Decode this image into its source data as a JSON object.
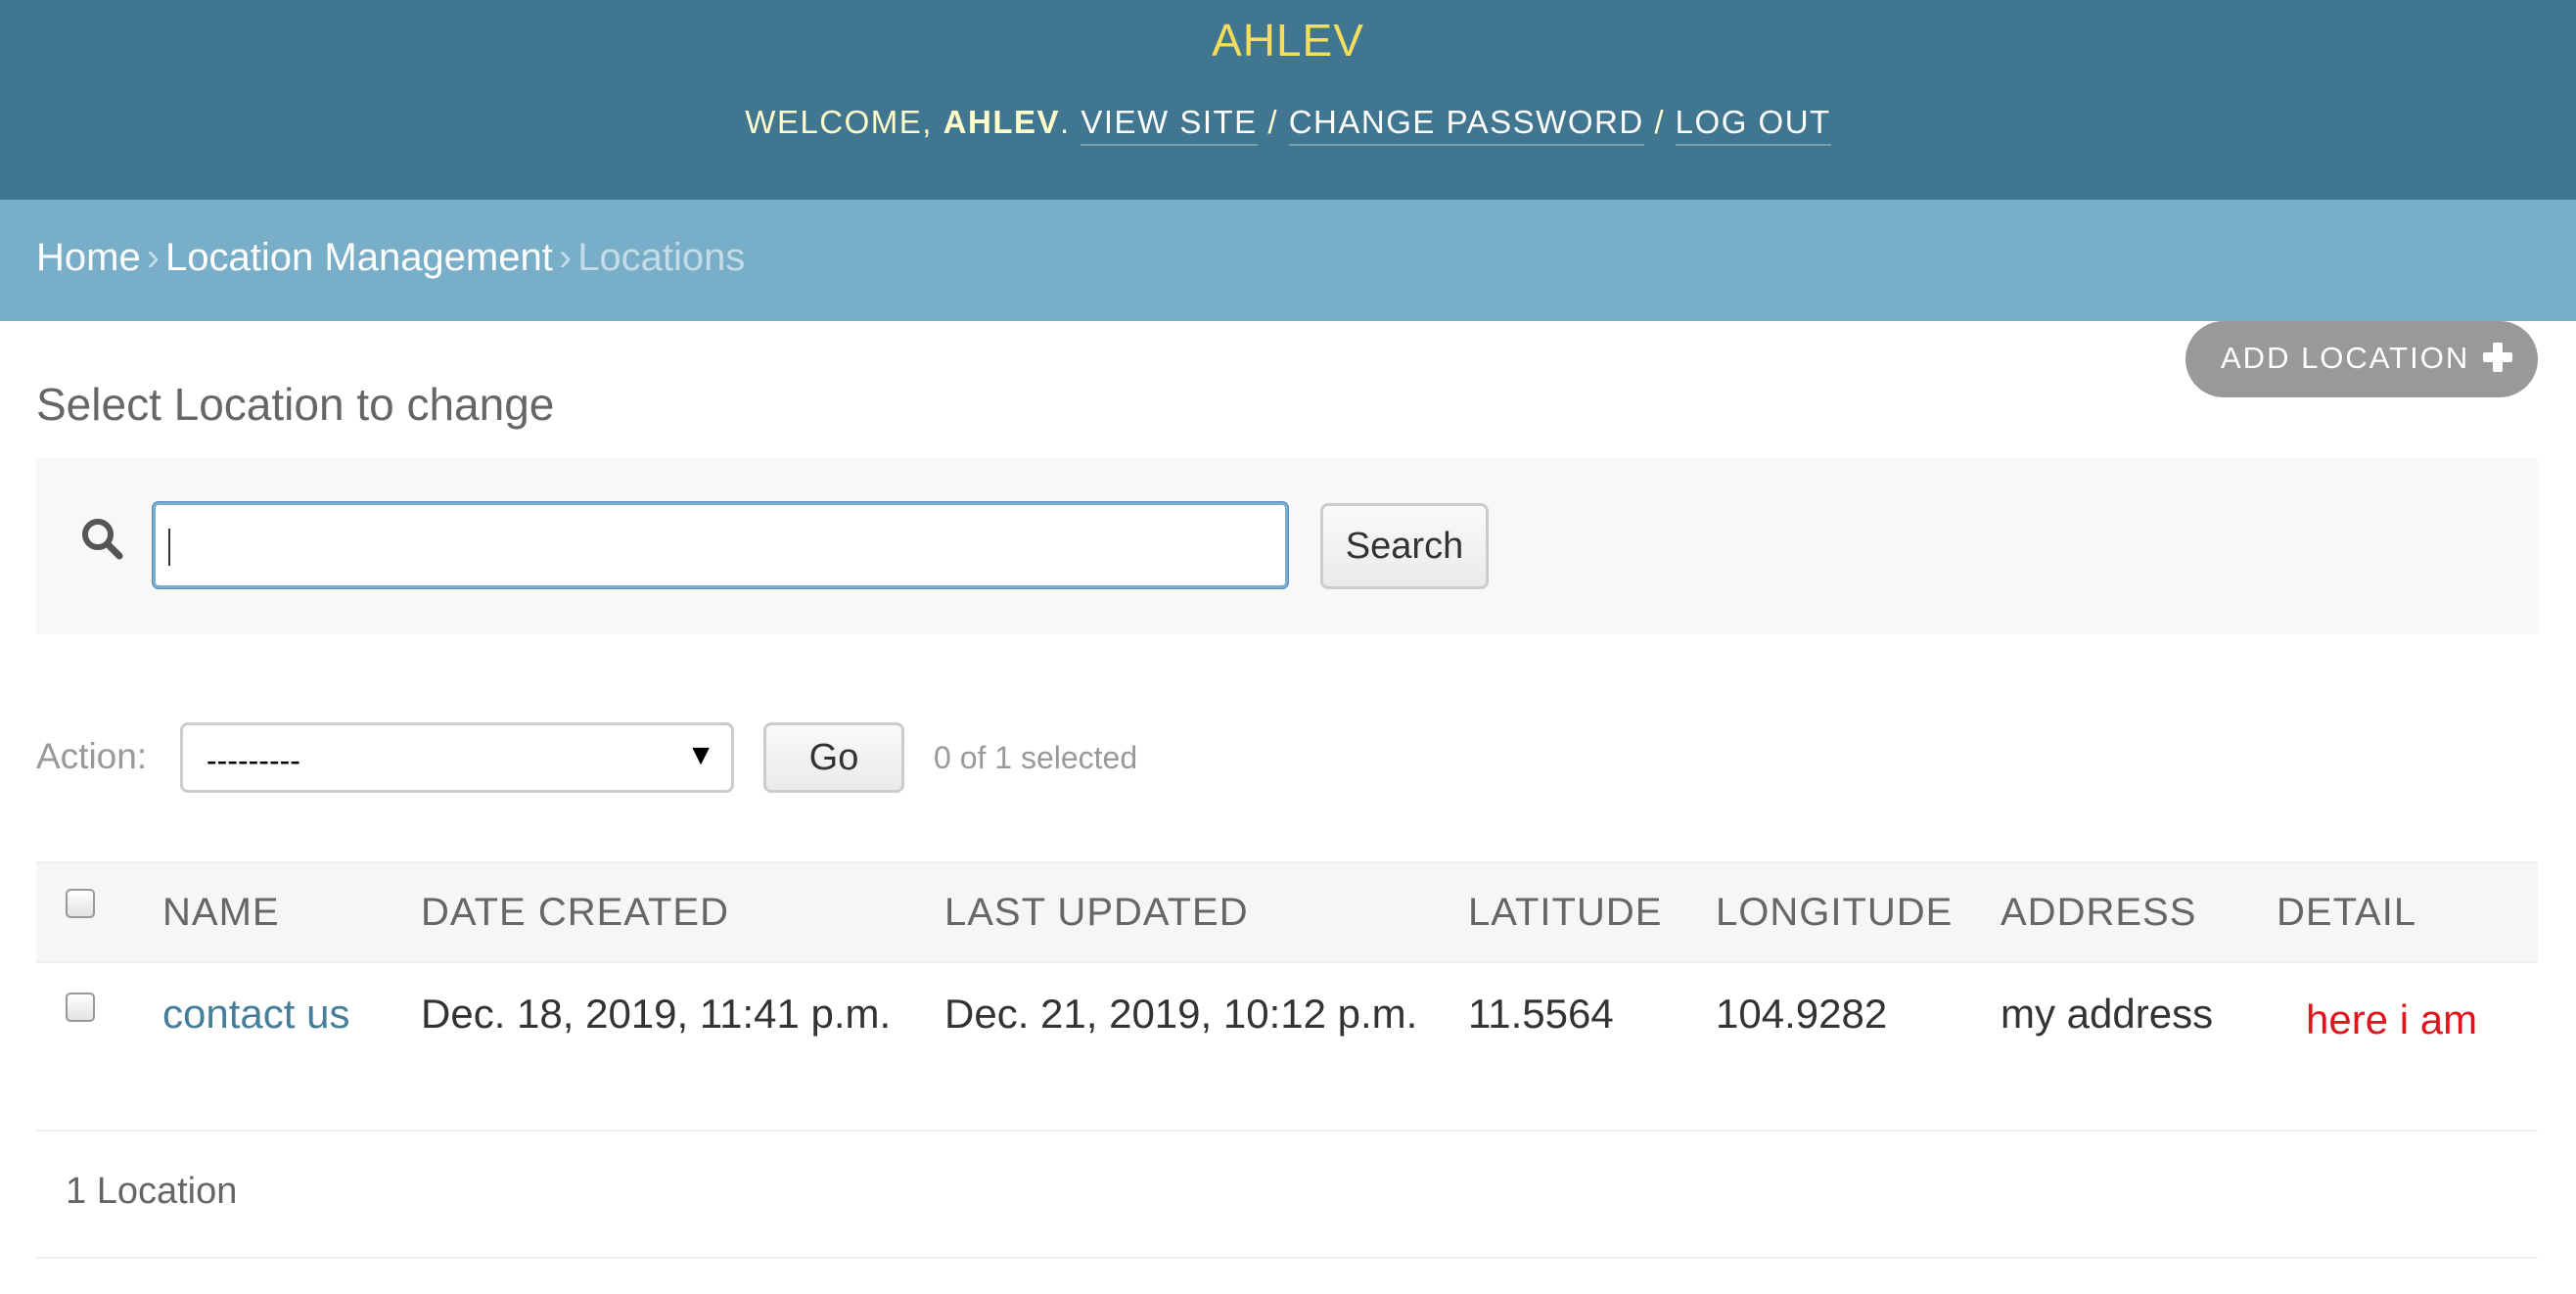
{
  "header": {
    "site_name": "AHLEV",
    "welcome_prefix": "WELCOME, ",
    "username": "AHLEV",
    "welcome_suffix": ". ",
    "view_site": "VIEW SITE",
    "change_password": "CHANGE PASSWORD",
    "log_out": "LOG OUT",
    "separator": " / ",
    "colors": {
      "bar": "#417690",
      "brand": "#f5dd5d",
      "text": "#ffffcc"
    }
  },
  "breadcrumbs": {
    "items": [
      "Home",
      "Location Management",
      "Locations"
    ],
    "separator": "›"
  },
  "object_tools": {
    "add_label": "ADD LOCATION",
    "icon": "plus-icon"
  },
  "page_title": "Select Location to change",
  "search": {
    "value": "",
    "button_label": "Search",
    "icon": "search-icon"
  },
  "actions": {
    "label": "Action:",
    "selected_option": "---------",
    "go_label": "Go",
    "counter": "0 of 1 selected"
  },
  "table": {
    "columns": [
      "NAME",
      "DATE CREATED",
      "LAST UPDATED",
      "LATITUDE",
      "LONGITUDE",
      "ADDRESS",
      "DETAIL"
    ],
    "rows": [
      {
        "name": "contact us",
        "date_created": "Dec. 18, 2019, 11:41 p.m.",
        "last_updated": "Dec. 21, 2019, 10:12 p.m.",
        "latitude": "11.5564",
        "longitude": "104.9282",
        "address": "my address",
        "detail": "here i am"
      }
    ]
  },
  "result_count": "1 Location"
}
